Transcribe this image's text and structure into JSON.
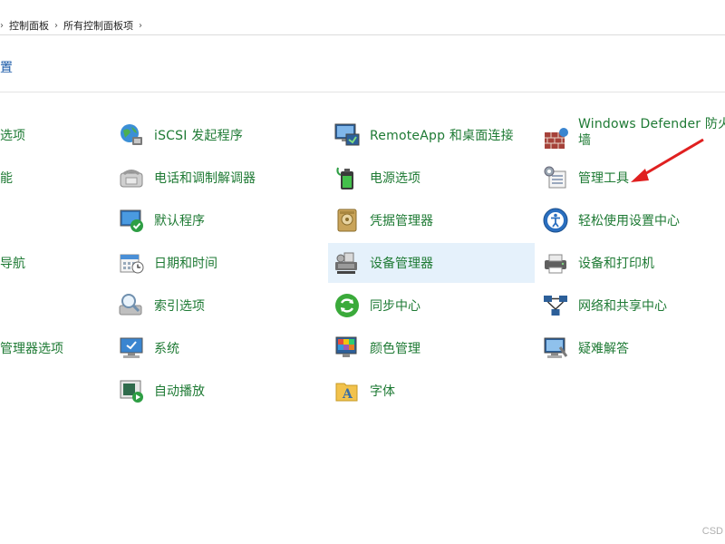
{
  "breadcrumb": {
    "items": [
      "控制面板",
      "所有控制面板项"
    ]
  },
  "header": {
    "title": "置"
  },
  "items": {
    "col0": [
      "选项",
      "能",
      "导航",
      "管理器选项"
    ],
    "col1": [
      "iSCSI 发起程序",
      "电话和调制解调器",
      "默认程序",
      "日期和时间",
      "索引选项",
      "系统",
      "自动播放"
    ],
    "col2": [
      "RemoteApp 和桌面连接",
      "电源选项",
      "凭据管理器",
      "设备管理器",
      "同步中心",
      "颜色管理",
      "字体"
    ],
    "col3": [
      "Windows Defender 防火",
      "墙",
      "管理工具",
      "轻松使用设置中心",
      "设备和打印机",
      "网络和共享中心",
      "疑难解答"
    ]
  },
  "selected_item": "设备管理器",
  "watermark": "CSD",
  "icons": {
    "col1": [
      "iscsi-globe-icon",
      "telephone-modem-icon",
      "default-programs-icon",
      "date-time-icon",
      "indexing-options-icon",
      "system-monitor-icon",
      "autoplay-icon"
    ],
    "col2": [
      "remoteapp-icon",
      "power-options-icon",
      "credential-vault-icon",
      "device-manager-icon",
      "sync-center-icon",
      "color-management-icon",
      "fonts-folder-icon"
    ],
    "col3": [
      "firewall-wall-icon",
      "administrative-tools-icon",
      "ease-of-access-icon",
      "devices-printers-icon",
      "network-sharing-icon",
      "troubleshooting-icon"
    ]
  },
  "colors": {
    "link_green": "#1e7a34",
    "title_blue": "#1a5aa8",
    "selection": "#e5f1fb",
    "annotation_arrow": "#e02020"
  }
}
